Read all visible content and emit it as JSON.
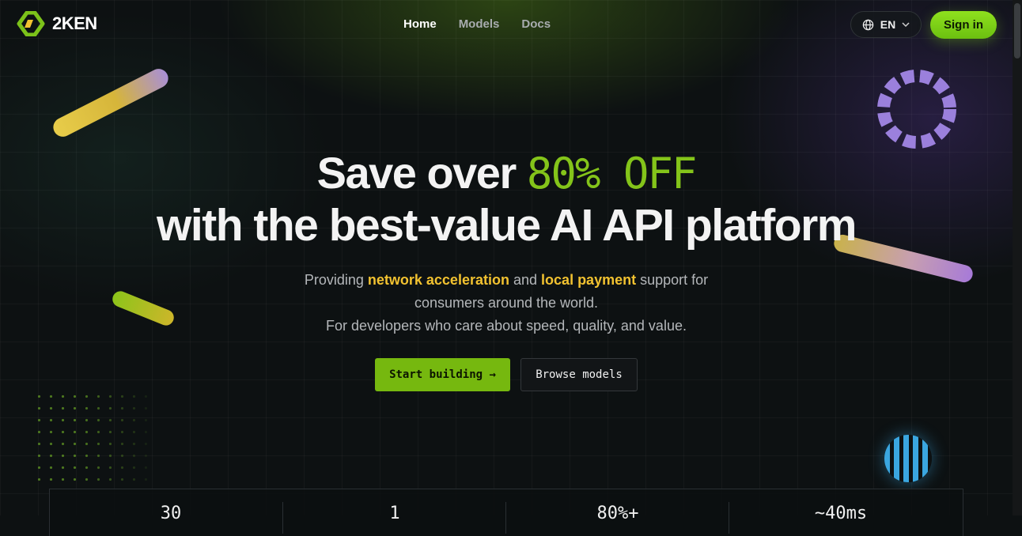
{
  "brand": {
    "name": "2KEN",
    "accent_color": "#84c41a"
  },
  "nav": {
    "items": [
      {
        "label": "Home",
        "active": true
      },
      {
        "label": "Models",
        "active": false
      },
      {
        "label": "Docs",
        "active": false
      }
    ]
  },
  "header": {
    "language": "EN",
    "signin_label": "Sign in",
    "globe_icon": "globe-icon",
    "chevron_icon": "chevron-down-icon"
  },
  "hero": {
    "title_prefix": "Save over",
    "title_accent": "80% OFF",
    "title_line2": "with the best-value AI API platform",
    "sub_part1": "Providing",
    "sub_highlight1": "network acceleration",
    "sub_part2": "and",
    "sub_highlight2": "local payment",
    "sub_part3": "support for consumers around the world.",
    "sub_line2": "For developers who care about speed, quality, and value.",
    "highlight_color": "#f2c230"
  },
  "actions": {
    "primary": "Start building →",
    "secondary": "Browse models"
  },
  "stats": [
    {
      "value": "30"
    },
    {
      "value": "1"
    },
    {
      "value": "80%+"
    },
    {
      "value": "~40ms"
    }
  ]
}
